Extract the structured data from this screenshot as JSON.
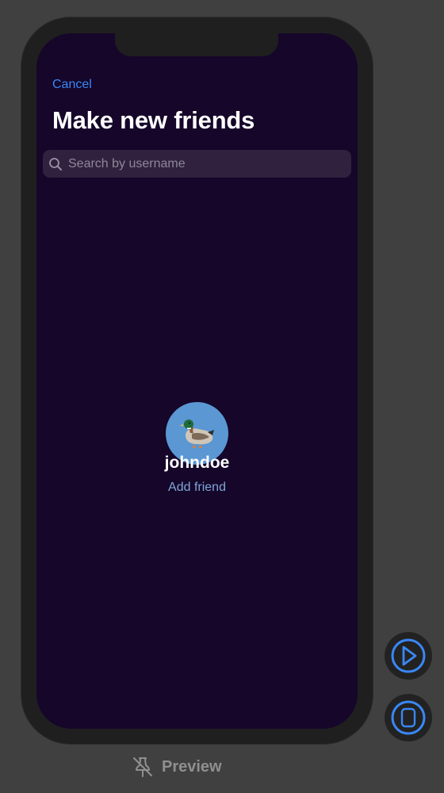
{
  "nav": {
    "cancel_label": "Cancel",
    "title": "Make new friends"
  },
  "search": {
    "placeholder": "Search by username",
    "value": ""
  },
  "result": {
    "avatar_icon": "duck-icon",
    "username": "johndoe",
    "add_friend_label": "Add friend"
  },
  "canvas": {
    "preview_label": "Preview",
    "pin_icon": "preview-pin-icon"
  },
  "colors": {
    "background": "#15062a",
    "accent": "#3a87f5",
    "avatar": "#5a97d3",
    "search_field": "#30223f"
  }
}
